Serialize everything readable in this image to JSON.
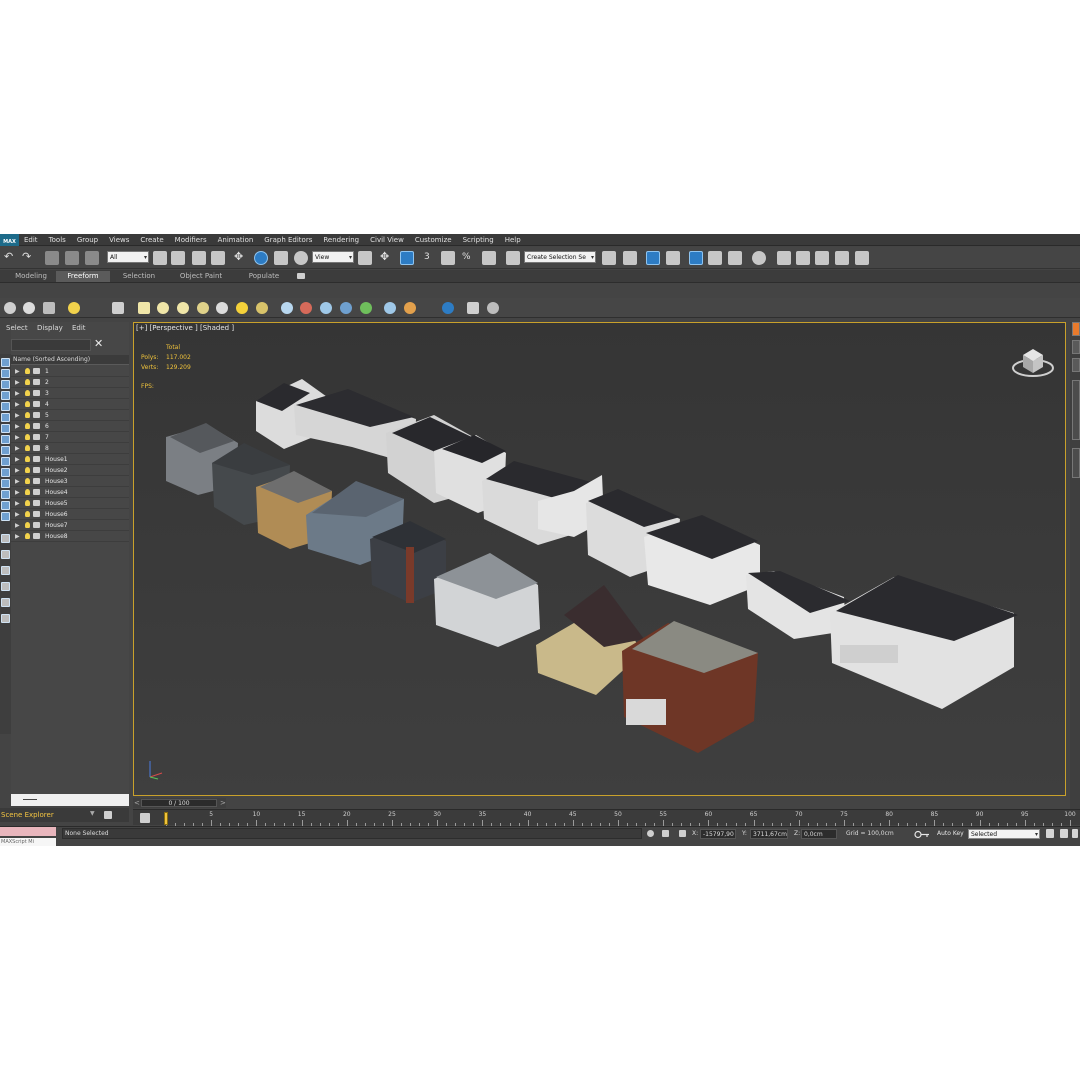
{
  "menu": {
    "logo": "MAX",
    "items": [
      "Edit",
      "Tools",
      "Group",
      "Views",
      "Create",
      "Modifiers",
      "Animation",
      "Graph Editors",
      "Rendering",
      "Civil View",
      "Customize",
      "Scripting",
      "Help"
    ]
  },
  "toolbar": {
    "filter_value": "All",
    "coord_system": "View",
    "named_selection_placeholder": "Create Selection Se",
    "snap_number": "3",
    "percent_snap": "%"
  },
  "ribbon": {
    "tabs": [
      "Modeling",
      "Freeform",
      "Selection",
      "Object Paint",
      "Populate"
    ],
    "active_tab": "Freeform"
  },
  "scene_explorer": {
    "menu": [
      "Select",
      "Display",
      "Edit"
    ],
    "column_header": "Name (Sorted Ascending)",
    "items": [
      "1",
      "2",
      "3",
      "4",
      "5",
      "6",
      "7",
      "8",
      "House1",
      "House2",
      "House3",
      "House4",
      "House5",
      "House6",
      "House7",
      "House8"
    ],
    "footer_label": "Scene Explorer"
  },
  "viewport": {
    "label": "[+] [Perspective ] [Shaded ]",
    "stats_header": "Total",
    "polys_label": "Polys:",
    "polys_value": "117.002",
    "verts_label": "Verts:",
    "verts_value": "129.209",
    "fps_label": "FPS:"
  },
  "timeline": {
    "frame_display": "0 / 100",
    "ticks": [
      "5",
      "10",
      "15",
      "20",
      "25",
      "30",
      "35",
      "40",
      "45",
      "50",
      "55",
      "60",
      "65",
      "70",
      "75",
      "80",
      "85",
      "90",
      "95",
      "100"
    ]
  },
  "status": {
    "listener_text": "MAXScript Mi",
    "message": "None Selected",
    "x_label": "X:",
    "x_value": "-15797,90",
    "y_label": "Y:",
    "y_value": "3711,67cm",
    "z_label": "Z:",
    "z_value": "0,0cm",
    "grid": "Grid = 100,0cm",
    "auto_key_label": "Auto Key",
    "key_filter": "Selected"
  },
  "colors": {
    "viewport_border": "#c9a12b",
    "stats_text": "#f0c33c",
    "active_tool": "#2d7cc4"
  }
}
